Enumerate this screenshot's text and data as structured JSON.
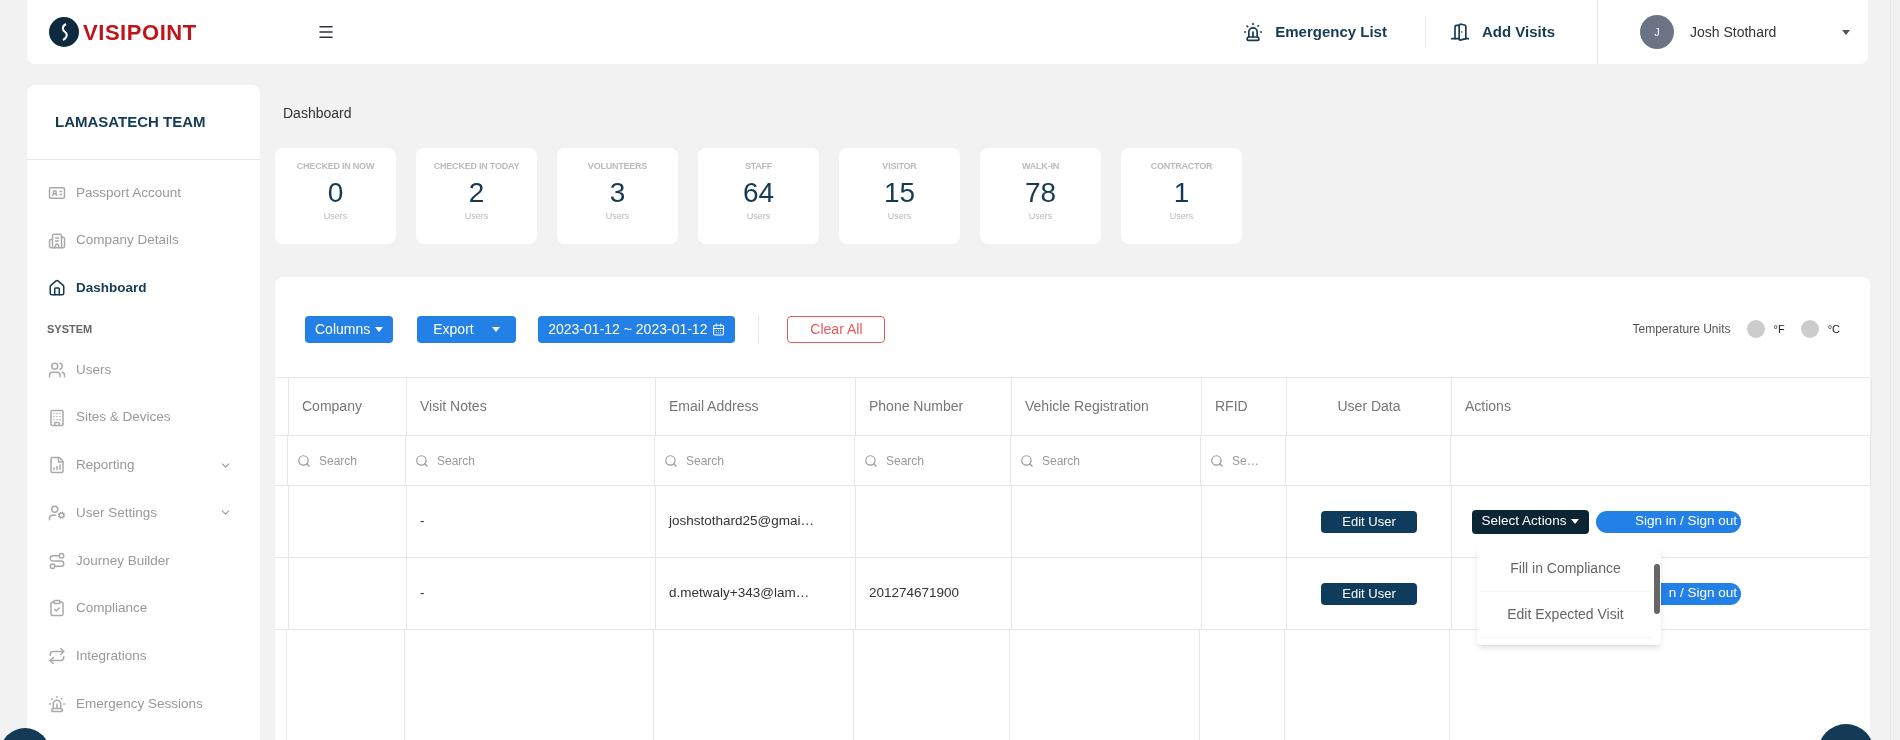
{
  "header": {
    "logo": "VISIPOINT",
    "actions": [
      {
        "label": "Emergency List"
      },
      {
        "label": "Add Visits"
      }
    ],
    "user": {
      "initial": "J",
      "name": "Josh Stothard"
    }
  },
  "sidebar": {
    "title": "LAMASATECH TEAM",
    "sections": [
      {
        "items": [
          {
            "label": "Passport Account",
            "selected": false,
            "expandable": false
          },
          {
            "label": "Company Details",
            "selected": false,
            "expandable": false
          },
          {
            "label": "Dashboard",
            "selected": true,
            "expandable": false
          }
        ]
      },
      {
        "heading": "SYSTEM",
        "items": [
          {
            "label": "Users",
            "selected": false,
            "expandable": false
          },
          {
            "label": "Sites & Devices",
            "selected": false,
            "expandable": false
          },
          {
            "label": "Reporting",
            "selected": false,
            "expandable": true
          },
          {
            "label": "User Settings",
            "selected": false,
            "expandable": true
          },
          {
            "label": "Journey Builder",
            "selected": false,
            "expandable": false
          },
          {
            "label": "Compliance",
            "selected": false,
            "expandable": false
          },
          {
            "label": "Integrations",
            "selected": false,
            "expandable": false
          },
          {
            "label": "Emergency Sessions",
            "selected": false,
            "expandable": false
          }
        ]
      }
    ]
  },
  "breadcrumb": "Dashboard",
  "stats": [
    {
      "label": "CHECKED IN NOW",
      "value": "0",
      "unit": "Users"
    },
    {
      "label": "CHECKED IN TODAY",
      "value": "2",
      "unit": "Users"
    },
    {
      "label": "VOLUNTEERS",
      "value": "3",
      "unit": "Users"
    },
    {
      "label": "STAFF",
      "value": "64",
      "unit": "Users"
    },
    {
      "label": "VISITOR",
      "value": "15",
      "unit": "Users"
    },
    {
      "label": "WALK-IN",
      "value": "78",
      "unit": "Users"
    },
    {
      "label": "CONTRACTOR",
      "value": "1",
      "unit": "Users"
    }
  ],
  "toolbar": {
    "columns": "Columns",
    "export": "Export",
    "date_range": "2023-01-12 ~ 2023-01-12",
    "clear": "Clear All",
    "temperature": {
      "label": "Temperature Units",
      "options": [
        {
          "label": "°F",
          "selected": false
        },
        {
          "label": "°C",
          "selected": false
        }
      ]
    }
  },
  "table": {
    "columns": [
      "",
      "Company",
      "Visit Notes",
      "Email Address",
      "Phone Number",
      "Vehicle Registration",
      "RFID",
      "User Data",
      "Actions"
    ],
    "search_placeholders": [
      "Search",
      "Search",
      "Search",
      "Search",
      "Search",
      "Se…"
    ],
    "rows": [
      {
        "cells": [
          "",
          "",
          "-",
          "joshstothard25@gmai…",
          "",
          "",
          "",
          ""
        ],
        "edit": "Edit User",
        "select_actions": "Select Actions",
        "sign": "Sign in / Sign out"
      },
      {
        "cells": [
          "",
          "",
          "-",
          "d.metwaly+343@lam…",
          "201274671900",
          "",
          "",
          ""
        ],
        "edit": "Edit User",
        "select_actions": null,
        "sign": "n / Sign out"
      }
    ],
    "menu": {
      "items": [
        "Fill in Compliance",
        "Edit Expected Visit"
      ]
    }
  }
}
